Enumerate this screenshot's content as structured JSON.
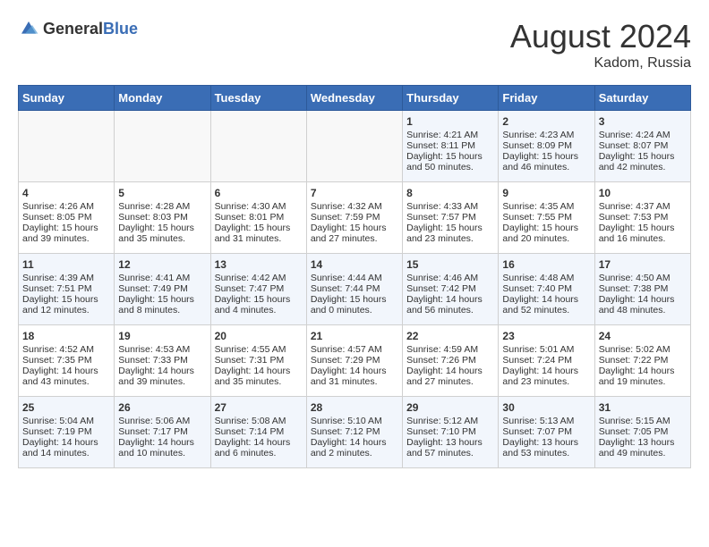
{
  "header": {
    "logo_general": "General",
    "logo_blue": "Blue",
    "month_year": "August 2024",
    "location": "Kadom, Russia"
  },
  "days_of_week": [
    "Sunday",
    "Monday",
    "Tuesday",
    "Wednesday",
    "Thursday",
    "Friday",
    "Saturday"
  ],
  "weeks": [
    [
      {
        "day": "",
        "info": ""
      },
      {
        "day": "",
        "info": ""
      },
      {
        "day": "",
        "info": ""
      },
      {
        "day": "",
        "info": ""
      },
      {
        "day": "1",
        "info": "Sunrise: 4:21 AM\nSunset: 8:11 PM\nDaylight: 15 hours\nand 50 minutes."
      },
      {
        "day": "2",
        "info": "Sunrise: 4:23 AM\nSunset: 8:09 PM\nDaylight: 15 hours\nand 46 minutes."
      },
      {
        "day": "3",
        "info": "Sunrise: 4:24 AM\nSunset: 8:07 PM\nDaylight: 15 hours\nand 42 minutes."
      }
    ],
    [
      {
        "day": "4",
        "info": "Sunrise: 4:26 AM\nSunset: 8:05 PM\nDaylight: 15 hours\nand 39 minutes."
      },
      {
        "day": "5",
        "info": "Sunrise: 4:28 AM\nSunset: 8:03 PM\nDaylight: 15 hours\nand 35 minutes."
      },
      {
        "day": "6",
        "info": "Sunrise: 4:30 AM\nSunset: 8:01 PM\nDaylight: 15 hours\nand 31 minutes."
      },
      {
        "day": "7",
        "info": "Sunrise: 4:32 AM\nSunset: 7:59 PM\nDaylight: 15 hours\nand 27 minutes."
      },
      {
        "day": "8",
        "info": "Sunrise: 4:33 AM\nSunset: 7:57 PM\nDaylight: 15 hours\nand 23 minutes."
      },
      {
        "day": "9",
        "info": "Sunrise: 4:35 AM\nSunset: 7:55 PM\nDaylight: 15 hours\nand 20 minutes."
      },
      {
        "day": "10",
        "info": "Sunrise: 4:37 AM\nSunset: 7:53 PM\nDaylight: 15 hours\nand 16 minutes."
      }
    ],
    [
      {
        "day": "11",
        "info": "Sunrise: 4:39 AM\nSunset: 7:51 PM\nDaylight: 15 hours\nand 12 minutes."
      },
      {
        "day": "12",
        "info": "Sunrise: 4:41 AM\nSunset: 7:49 PM\nDaylight: 15 hours\nand 8 minutes."
      },
      {
        "day": "13",
        "info": "Sunrise: 4:42 AM\nSunset: 7:47 PM\nDaylight: 15 hours\nand 4 minutes."
      },
      {
        "day": "14",
        "info": "Sunrise: 4:44 AM\nSunset: 7:44 PM\nDaylight: 15 hours\nand 0 minutes."
      },
      {
        "day": "15",
        "info": "Sunrise: 4:46 AM\nSunset: 7:42 PM\nDaylight: 14 hours\nand 56 minutes."
      },
      {
        "day": "16",
        "info": "Sunrise: 4:48 AM\nSunset: 7:40 PM\nDaylight: 14 hours\nand 52 minutes."
      },
      {
        "day": "17",
        "info": "Sunrise: 4:50 AM\nSunset: 7:38 PM\nDaylight: 14 hours\nand 48 minutes."
      }
    ],
    [
      {
        "day": "18",
        "info": "Sunrise: 4:52 AM\nSunset: 7:35 PM\nDaylight: 14 hours\nand 43 minutes."
      },
      {
        "day": "19",
        "info": "Sunrise: 4:53 AM\nSunset: 7:33 PM\nDaylight: 14 hours\nand 39 minutes."
      },
      {
        "day": "20",
        "info": "Sunrise: 4:55 AM\nSunset: 7:31 PM\nDaylight: 14 hours\nand 35 minutes."
      },
      {
        "day": "21",
        "info": "Sunrise: 4:57 AM\nSunset: 7:29 PM\nDaylight: 14 hours\nand 31 minutes."
      },
      {
        "day": "22",
        "info": "Sunrise: 4:59 AM\nSunset: 7:26 PM\nDaylight: 14 hours\nand 27 minutes."
      },
      {
        "day": "23",
        "info": "Sunrise: 5:01 AM\nSunset: 7:24 PM\nDaylight: 14 hours\nand 23 minutes."
      },
      {
        "day": "24",
        "info": "Sunrise: 5:02 AM\nSunset: 7:22 PM\nDaylight: 14 hours\nand 19 minutes."
      }
    ],
    [
      {
        "day": "25",
        "info": "Sunrise: 5:04 AM\nSunset: 7:19 PM\nDaylight: 14 hours\nand 14 minutes."
      },
      {
        "day": "26",
        "info": "Sunrise: 5:06 AM\nSunset: 7:17 PM\nDaylight: 14 hours\nand 10 minutes."
      },
      {
        "day": "27",
        "info": "Sunrise: 5:08 AM\nSunset: 7:14 PM\nDaylight: 14 hours\nand 6 minutes."
      },
      {
        "day": "28",
        "info": "Sunrise: 5:10 AM\nSunset: 7:12 PM\nDaylight: 14 hours\nand 2 minutes."
      },
      {
        "day": "29",
        "info": "Sunrise: 5:12 AM\nSunset: 7:10 PM\nDaylight: 13 hours\nand 57 minutes."
      },
      {
        "day": "30",
        "info": "Sunrise: 5:13 AM\nSunset: 7:07 PM\nDaylight: 13 hours\nand 53 minutes."
      },
      {
        "day": "31",
        "info": "Sunrise: 5:15 AM\nSunset: 7:05 PM\nDaylight: 13 hours\nand 49 minutes."
      }
    ]
  ]
}
